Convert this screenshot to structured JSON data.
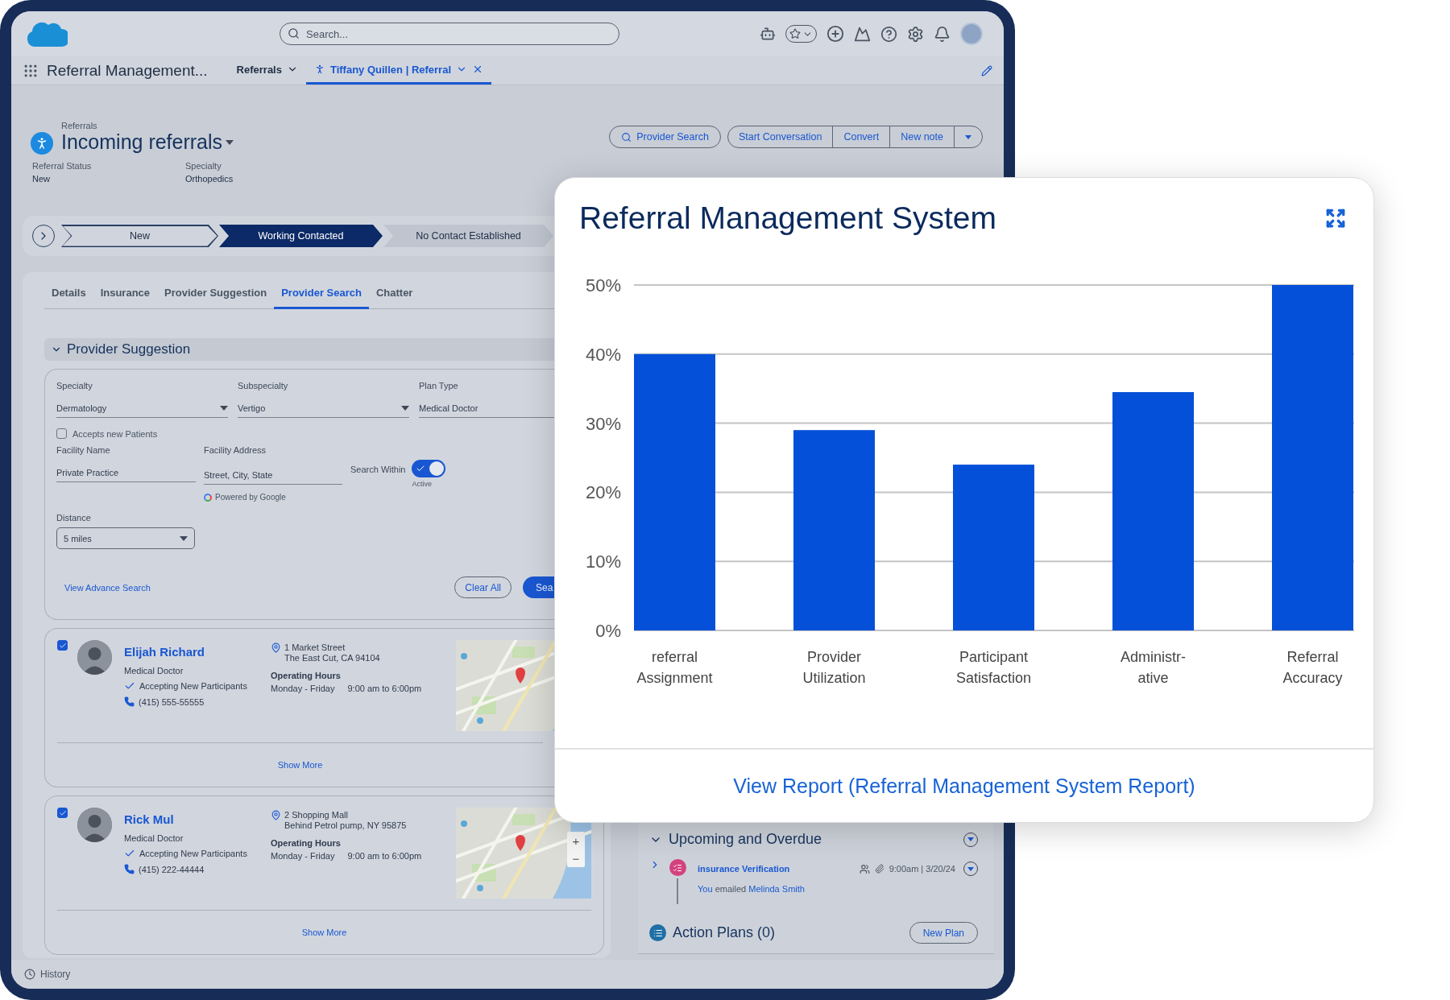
{
  "global_header": {
    "search": {
      "placeholder": "Search..."
    }
  },
  "nav": {
    "app_name": "Referral Management...",
    "items": [
      {
        "label": "Referrals",
        "selected": false,
        "closable": false
      },
      {
        "label": "Tiffany Quillen | Referral",
        "selected": true,
        "closable": true
      }
    ]
  },
  "record": {
    "object": "Referrals",
    "title": "Incoming referrals",
    "fields": [
      {
        "label": "Referral Status",
        "value": "New"
      },
      {
        "label": "Specialty",
        "value": "Orthopedics"
      }
    ],
    "primary_action": "Provider Search",
    "action_group": [
      "Start Conversation",
      "Convert",
      "New note"
    ]
  },
  "path": [
    {
      "label": "New",
      "completed": true,
      "selected": false
    },
    {
      "label": "Working Contacted",
      "completed": false,
      "selected": true
    },
    {
      "label": "No Contact Established",
      "completed": false,
      "selected": false
    }
  ],
  "tabs": [
    {
      "label": "Details",
      "selected": false
    },
    {
      "label": "Insurance",
      "selected": false
    },
    {
      "label": "Provider Suggestion",
      "selected": false
    },
    {
      "label": "Provider Search",
      "selected": true
    },
    {
      "label": "Chatter",
      "selected": false
    }
  ],
  "provider_suggestion": {
    "title": "Provider Suggestion",
    "expanded": true,
    "fields": [
      {
        "kind": "select",
        "label": "Specialty",
        "value": "Dermatology"
      },
      {
        "kind": "select",
        "label": "Subspecialty",
        "value": "Vertigo"
      },
      {
        "kind": "text",
        "label": "Plan Type",
        "value": "Medical Doctor"
      }
    ],
    "accepts_new": {
      "label": "Accepts new Patients",
      "checked": false
    },
    "facility_name": {
      "label": "Facility Name",
      "value": "Private Practice"
    },
    "facility_address": {
      "label": "Facility Address",
      "value": "Street, City, State",
      "attribution": "Powered by Google"
    },
    "search_within": {
      "label": "Search Within",
      "on": true,
      "status": "Active"
    },
    "distance": {
      "label": "Distance",
      "value": "5 miles"
    },
    "advanced_link": "View Advance Search",
    "buttons": [
      {
        "label": "Clear All",
        "kind": "outline"
      },
      {
        "label": "Sea",
        "kind": "primary"
      }
    ]
  },
  "providers": [
    {
      "checked": true,
      "name": "Elijah Richard",
      "role": "Medical Doctor",
      "accepting": "Accepting New Participants",
      "phone": "(415) 555-55555",
      "address": [
        "1 Market Street",
        "The East Cut, CA 94104"
      ],
      "hours_label": "Operating Hours",
      "days": "Monday - Friday",
      "hours": "9:00 am to 6:00pm",
      "map": {
        "kind": "picture"
      },
      "show_more": "Show More"
    },
    {
      "checked": true,
      "name": "Rick Mul",
      "role": "Medical Doctor",
      "accepting": "Accepting New Participants",
      "phone": "(415) 222-44444",
      "address": [
        "2 Shopping Mall",
        "Behind Petrol pump, NY 95875"
      ],
      "hours_label": "Operating Hours",
      "days": "Monday - Friday",
      "hours": "9:00 am to 6:00pm",
      "map": {
        "kind": "picture",
        "controls": [
          "+",
          "−"
        ]
      },
      "show_more": "Show More"
    }
  ],
  "activity": {
    "title": "Upcoming and Overdue",
    "expanded": true,
    "items": [
      {
        "title": "insurance Verification",
        "time": "9:00am | 3/20/24",
        "actor": "You",
        "action": "emailed",
        "target": "Melinda Smith"
      }
    ]
  },
  "action_plans": {
    "title": "Action Plans (0)",
    "button": "New Plan"
  },
  "footer": {
    "label": "History"
  },
  "report_card": {
    "title": "Referral Management System",
    "link": "View Report (Referral Management System Report)",
    "chart_data": {
      "type": "bar",
      "grid": true,
      "categories": [
        "referral Assignment",
        "Provider Utilization",
        "Participant Satisfaction",
        "Administr-ative",
        "Referral Accuracy"
      ],
      "series": [
        {
          "color": "#0450d8",
          "values": [
            40,
            29,
            24,
            34.5,
            50
          ]
        }
      ],
      "ylim": [
        0,
        50
      ],
      "yticks": [
        {
          "value": 0,
          "label": "0%"
        },
        {
          "value": 10,
          "label": "10%"
        },
        {
          "value": 20,
          "label": "20%"
        },
        {
          "value": 30,
          "label": "30%"
        },
        {
          "value": 40,
          "label": "40%"
        },
        {
          "value": 50,
          "label": "50%"
        }
      ]
    }
  }
}
